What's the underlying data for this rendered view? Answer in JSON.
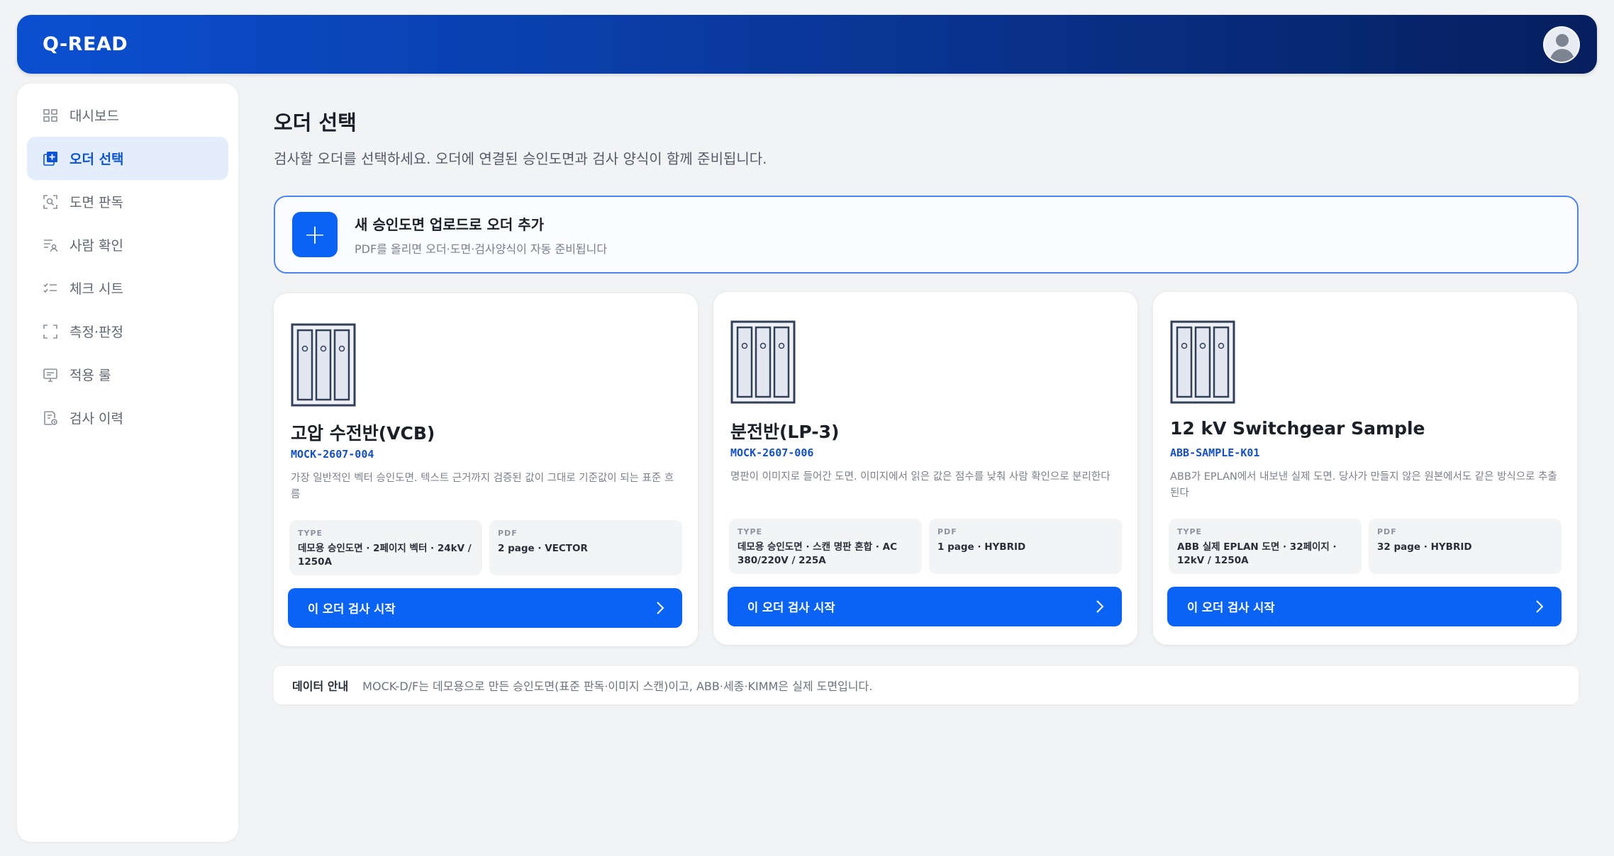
{
  "app": {
    "brand": "Q-READ"
  },
  "sidebar": {
    "items": [
      {
        "label": "대시보드",
        "icon": "dashboard-icon",
        "active": false
      },
      {
        "label": "오더 선택",
        "icon": "add-order-icon",
        "active": true
      },
      {
        "label": "도면 판독",
        "icon": "scan-icon",
        "active": false
      },
      {
        "label": "사람 확인",
        "icon": "person-check-icon",
        "active": false
      },
      {
        "label": "체크 시트",
        "icon": "checklist-icon",
        "active": false
      },
      {
        "label": "측정·판정",
        "icon": "measure-icon",
        "active": false
      },
      {
        "label": "적용 룰",
        "icon": "rules-icon",
        "active": false
      },
      {
        "label": "검사 이력",
        "icon": "history-icon",
        "active": false
      }
    ]
  },
  "page": {
    "title": "오더 선택",
    "subtitle": "검사할 오더를 선택하세요. 오더에 연결된 승인도면과 검사 양식이 함께 준비됩니다."
  },
  "upload": {
    "plus": "+",
    "title": "새 승인도면 업로드로 오더 추가",
    "subtitle": "PDF를 올리면 오더·도면·검사양식이 자동 준비됩니다"
  },
  "cards": [
    {
      "title": "고압 수전반(VCB)",
      "code": "MOCK-2607-004",
      "desc": "가장 일반적인 벡터 승인도면. 텍스트 근거까지 검증된 값이 그대로 기준값이 되는 표준 흐름",
      "type_label": "TYPE",
      "type_value": "데모용 승인도면 · 2페이지 벡터 · 24kV / 1250A",
      "pdf_label": "PDF",
      "pdf_value": "2 page · VECTOR",
      "button": "이 오더 검사 시작"
    },
    {
      "title": "분전반(LP-3)",
      "code": "MOCK-2607-006",
      "desc": "명판이 이미지로 들어간 도면. 이미지에서 읽은 값은 점수를 낮춰 사람 확인으로 분리한다",
      "type_label": "TYPE",
      "type_value": "데모용 승인도면 · 스캔 명판 혼합 · AC 380/220V / 225A",
      "pdf_label": "PDF",
      "pdf_value": "1 page · HYBRID",
      "button": "이 오더 검사 시작"
    },
    {
      "title": "12 kV Switchgear Sample",
      "code": "ABB-SAMPLE-K01",
      "desc": "ABB가 EPLAN에서 내보낸 실제 도면. 당사가 만들지 않은 원본에서도 같은 방식으로 추출된다",
      "type_label": "TYPE",
      "type_value": "ABB 실제 EPLAN 도면 · 32페이지 · 12kV / 1250A",
      "pdf_label": "PDF",
      "pdf_value": "32 page · HYBRID",
      "button": "이 오더 검사 시작"
    }
  ],
  "notice": {
    "label": "데이터 안내",
    "text": "MOCK-D/F는 데모용으로 만든 승인도면(표준 판독·이미지 스캔)이고, ABB·세종·KIMM은 실제 도면입니다."
  },
  "colors": {
    "accent": "#0b63f6",
    "header_start": "#0b4fd1",
    "header_end": "#061f5e",
    "active_bg": "#e4edfc"
  }
}
